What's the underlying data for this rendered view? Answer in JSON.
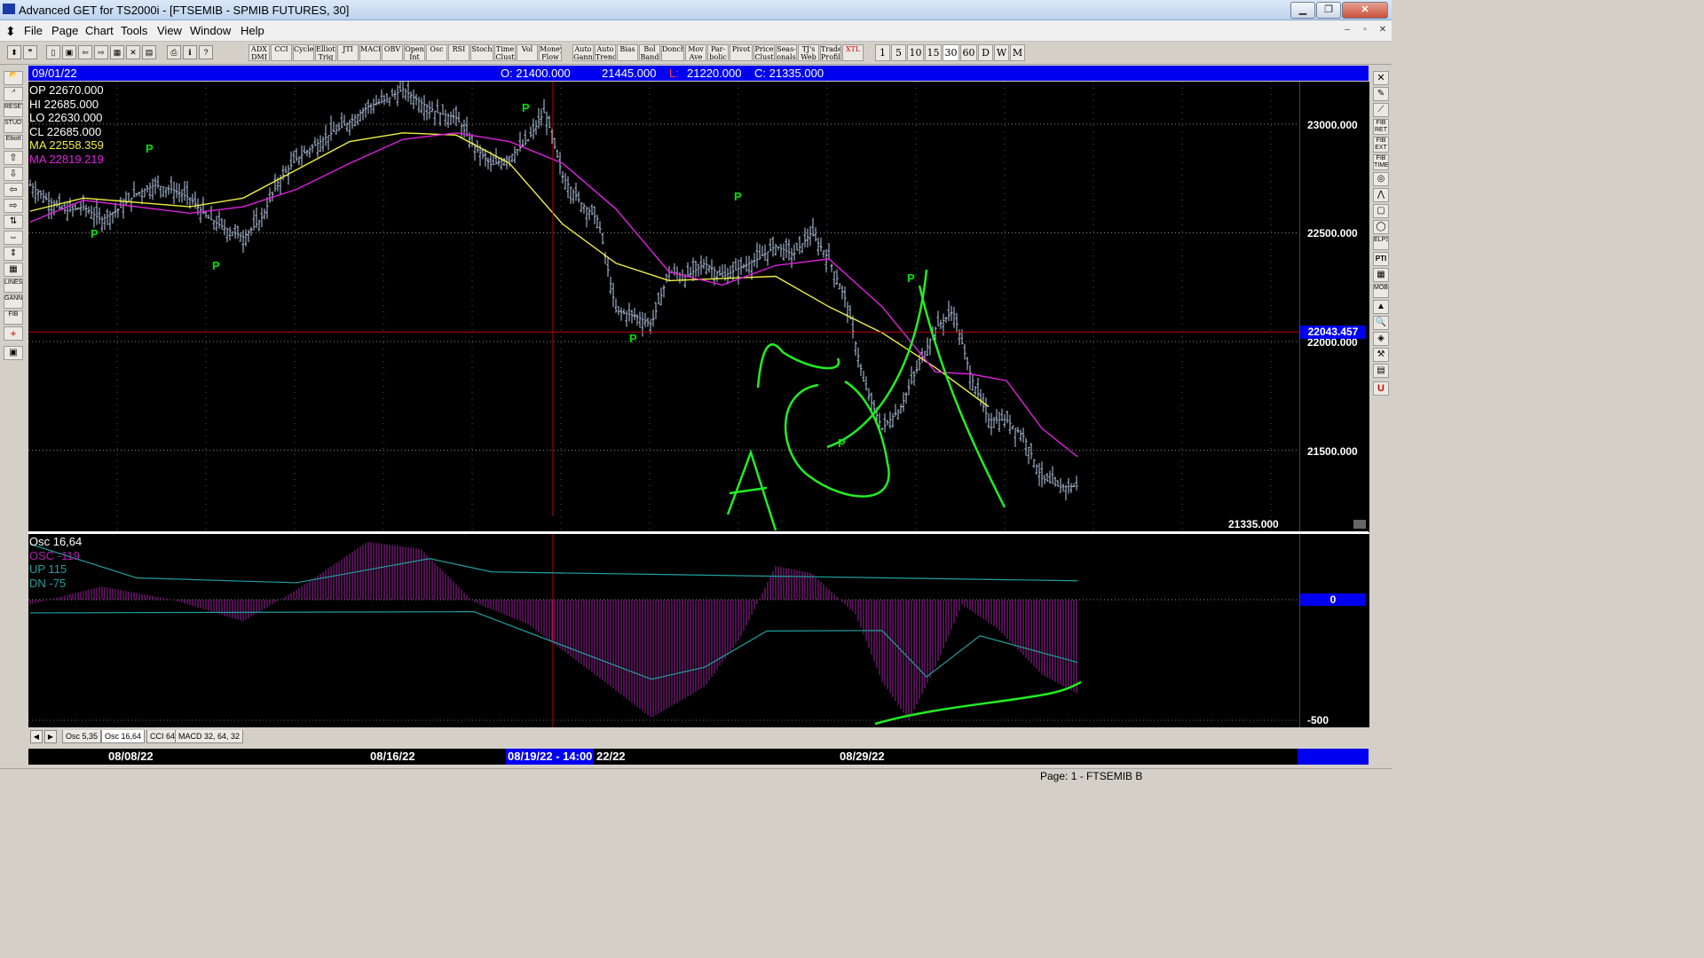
{
  "window": {
    "title": "Advanced GET for TS2000i - [FTSEMIB - SPMIB FUTURES, 30]",
    "minimize": "▁",
    "maximize": "❐",
    "close": "✕"
  },
  "menu": {
    "items": [
      "File",
      "Page",
      "Chart",
      "Tools",
      "View",
      "Window",
      "Help"
    ],
    "mdi": [
      "–",
      "▫",
      "✕"
    ]
  },
  "toolbar": {
    "icons": [
      "pin-icon",
      "quote-icon",
      "new-icon",
      "print-preview-icon",
      "back-icon",
      "forward-icon",
      "grid-icon",
      "cross-icon",
      "table-icon",
      "printer-icon",
      "info-icon",
      "help-icon"
    ],
    "study_buttons": [
      "ADX DMI",
      "CCI",
      "Cycles",
      "Elliott Trig",
      "JTI",
      "MACD",
      "OBV",
      "Open Int",
      "Osc",
      "RSI",
      "Stoch",
      "Time Clust",
      "Vol",
      "Money Flow",
      "Auto Gann",
      "Auto Trend",
      "Bias",
      "Bol Band",
      "Donch",
      "Mov Ave",
      "Par-bolic",
      "Pivot",
      "Price Clust",
      "Seas-onals",
      "TJ's Web",
      "Trade Profile",
      "XTL"
    ],
    "intervals": [
      "1",
      "5",
      "10",
      "15",
      "30",
      "60",
      "D",
      "W",
      "M"
    ]
  },
  "left_tools": [
    "open",
    "draw",
    "reset",
    "study",
    "elliott",
    "up",
    "down",
    "left",
    "right",
    "scale",
    "expand",
    "zoom",
    "lines",
    "gann",
    "fib",
    "cross",
    "save"
  ],
  "right_tools": [
    "close",
    "pen",
    "ruler",
    "FIB RET",
    "FIB EXT",
    "FIB TIME",
    "spiral",
    "fan",
    "box",
    "circle",
    "ELPS",
    "PTI",
    "grid",
    "MOB",
    "arrow",
    "zoom",
    "marker",
    "tool",
    "book",
    "U"
  ],
  "info_bar": {
    "date": "09/01/22",
    "open": "O: 21400.000",
    "high": "21445.000",
    "low_label": "L:",
    "low": "21220.000",
    "close": "C: 21335.000"
  },
  "readout": {
    "op": "OP  22670.000",
    "hi": "HI   22685.000",
    "lo": "LO  22630.000",
    "cl": "CL  22685.000",
    "ma1": "MA  22558.359",
    "ma2": "MA  22819.219"
  },
  "price_axis": {
    "labels": [
      "23000.000",
      "22500.000",
      "22000.000",
      "21500.000"
    ],
    "crosshair_value": "22043.457",
    "last_price": "21335.000"
  },
  "oscillator": {
    "title": "Osc 16,64",
    "osc": "OSC -119",
    "up": "UP   115",
    "dn": "DN   -75",
    "axis_labels": [
      "0",
      "-500"
    ]
  },
  "tabs": [
    "Osc 5,35",
    "Osc 16,64",
    "CCI 64",
    "MACD 32, 64, 32"
  ],
  "dates": {
    "labels": [
      "08/08/22",
      "08/16/22",
      "22/22",
      "08/29/22"
    ],
    "cursor": "08/19/22 - 14:00"
  },
  "pivot_marker": "P",
  "annotation_letter": "A",
  "status": {
    "text": "Page: 1 - FTSEMIB B"
  },
  "colors": {
    "chart_bg": "#000000",
    "candle": "#b9cdea",
    "ma_yellow": "#f0f040",
    "ma_magenta": "#e020e0",
    "pivot_green": "#00e000",
    "drawing_green": "#22ee22",
    "osc_bar": "#a020a0",
    "osc_line": "#20a0a0",
    "crosshair": "#c00000",
    "info_blue": "#0000f0"
  },
  "chart_data": {
    "type": "candlestick",
    "instrument": "FTSEMIB - SPMIB FUTURES, 30",
    "ylim": [
      21250,
      23400
    ],
    "close_path": [
      [
        0,
        22720
      ],
      [
        20,
        22650
      ],
      [
        40,
        22600
      ],
      [
        60,
        22620
      ],
      [
        80,
        22560
      ],
      [
        100,
        22610
      ],
      [
        120,
        22680
      ],
      [
        140,
        22720
      ],
      [
        160,
        22700
      ],
      [
        180,
        22660
      ],
      [
        200,
        22570
      ],
      [
        220,
        22520
      ],
      [
        240,
        22480
      ],
      [
        260,
        22560
      ],
      [
        280,
        22740
      ],
      [
        300,
        22840
      ],
      [
        320,
        22900
      ],
      [
        340,
        22960
      ],
      [
        360,
        23010
      ],
      [
        380,
        23080
      ],
      [
        400,
        23110
      ],
      [
        420,
        23160
      ],
      [
        440,
        23100
      ],
      [
        460,
        23050
      ],
      [
        480,
        23030
      ],
      [
        500,
        22900
      ],
      [
        520,
        22810
      ],
      [
        540,
        22850
      ],
      [
        560,
        22920
      ],
      [
        580,
        23060
      ],
      [
        600,
        22760
      ],
      [
        620,
        22640
      ],
      [
        640,
        22560
      ],
      [
        660,
        22140
      ],
      [
        680,
        22120
      ],
      [
        700,
        22080
      ],
      [
        720,
        22320
      ],
      [
        740,
        22300
      ],
      [
        760,
        22360
      ],
      [
        780,
        22300
      ],
      [
        800,
        22340
      ],
      [
        820,
        22380
      ],
      [
        840,
        22440
      ],
      [
        860,
        22400
      ],
      [
        880,
        22500
      ],
      [
        900,
        22380
      ],
      [
        920,
        22180
      ],
      [
        940,
        21800
      ],
      [
        960,
        21600
      ],
      [
        980,
        21690
      ],
      [
        1000,
        21880
      ],
      [
        1020,
        22060
      ],
      [
        1040,
        22140
      ],
      [
        1060,
        21840
      ],
      [
        1080,
        21640
      ],
      [
        1100,
        21640
      ],
      [
        1120,
        21560
      ],
      [
        1140,
        21370
      ],
      [
        1160,
        21330
      ],
      [
        1180,
        21335
      ]
    ],
    "ma_yellow": [
      [
        0,
        22600
      ],
      [
        60,
        22660
      ],
      [
        120,
        22640
      ],
      [
        180,
        22620
      ],
      [
        240,
        22660
      ],
      [
        300,
        22790
      ],
      [
        360,
        22920
      ],
      [
        420,
        22960
      ],
      [
        480,
        22950
      ],
      [
        540,
        22820
      ],
      [
        600,
        22540
      ],
      [
        660,
        22360
      ],
      [
        720,
        22280
      ],
      [
        780,
        22290
      ],
      [
        840,
        22300
      ],
      [
        900,
        22160
      ],
      [
        960,
        22040
      ],
      [
        1020,
        21880
      ],
      [
        1080,
        21700
      ]
    ],
    "ma_magenta": [
      [
        0,
        22550
      ],
      [
        60,
        22650
      ],
      [
        120,
        22620
      ],
      [
        180,
        22590
      ],
      [
        240,
        22620
      ],
      [
        300,
        22700
      ],
      [
        360,
        22820
      ],
      [
        420,
        22930
      ],
      [
        480,
        22960
      ],
      [
        540,
        22920
      ],
      [
        600,
        22820
      ],
      [
        660,
        22610
      ],
      [
        720,
        22320
      ],
      [
        780,
        22260
      ],
      [
        840,
        22350
      ],
      [
        900,
        22380
      ],
      [
        960,
        22160
      ],
      [
        1020,
        21860
      ],
      [
        1060,
        21850
      ],
      [
        1100,
        21820
      ],
      [
        1140,
        21600
      ],
      [
        1180,
        21470
      ]
    ],
    "osc_bars": [
      [
        0,
        -20
      ],
      [
        80,
        55
      ],
      [
        160,
        0
      ],
      [
        240,
        -90
      ],
      [
        300,
        40
      ],
      [
        380,
        240
      ],
      [
        440,
        210
      ],
      [
        500,
        -10
      ],
      [
        560,
        -100
      ],
      [
        640,
        -320
      ],
      [
        700,
        -490
      ],
      [
        760,
        -360
      ],
      [
        800,
        -160
      ],
      [
        840,
        140
      ],
      [
        880,
        110
      ],
      [
        930,
        -60
      ],
      [
        960,
        -340
      ],
      [
        990,
        -500
      ],
      [
        1020,
        -280
      ],
      [
        1050,
        -20
      ],
      [
        1090,
        -120
      ],
      [
        1140,
        -310
      ],
      [
        1180,
        -390
      ]
    ],
    "osc_line_up": [
      [
        0,
        230
      ],
      [
        120,
        90
      ],
      [
        300,
        70
      ],
      [
        450,
        170
      ],
      [
        520,
        115
      ],
      [
        1180,
        78
      ]
    ],
    "osc_line_dn": [
      [
        0,
        -55
      ],
      [
        500,
        -50
      ],
      [
        700,
        -330
      ],
      [
        760,
        -280
      ],
      [
        830,
        -130
      ],
      [
        960,
        -128
      ],
      [
        1010,
        -320
      ],
      [
        1070,
        -150
      ],
      [
        1180,
        -260
      ]
    ]
  }
}
